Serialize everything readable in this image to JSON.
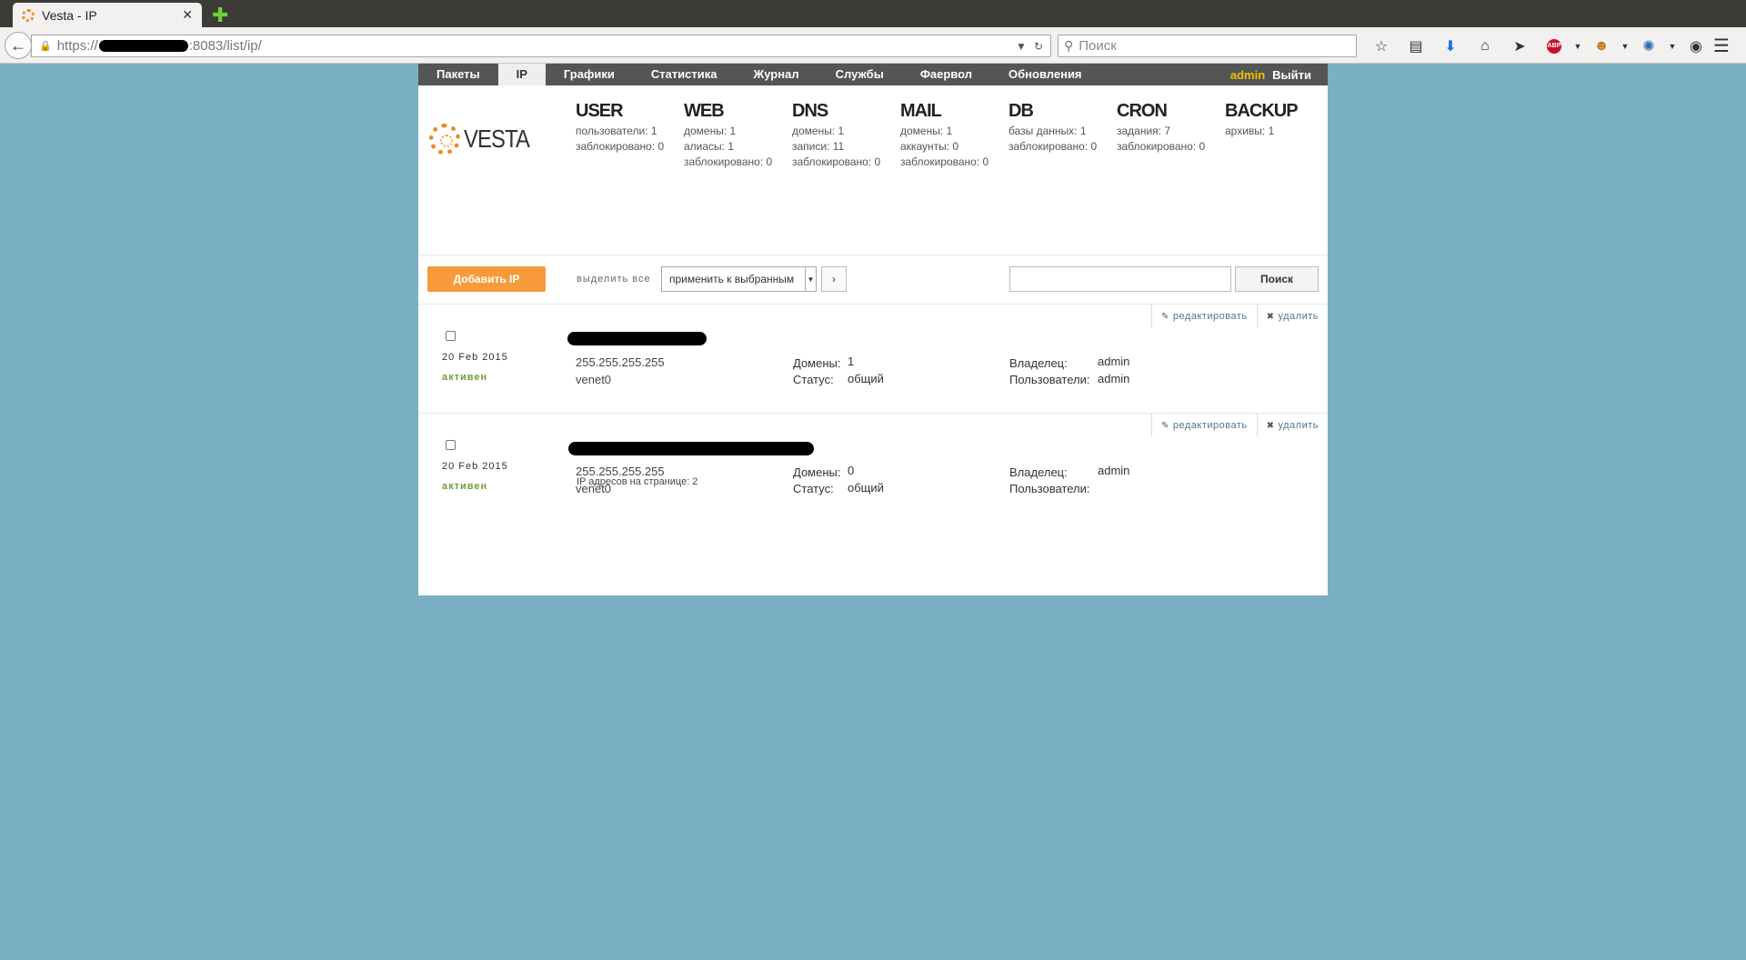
{
  "browser": {
    "tab_title": "Vesta - IP",
    "tab_close": "✕",
    "new_tab": "✚",
    "url_prefix": "https://",
    "url_suffix": ":8083/list/ip/",
    "search_placeholder": "Поиск"
  },
  "topmenu": {
    "items": [
      "Пакеты",
      "IP",
      "Графики",
      "Статистика",
      "Журнал",
      "Службы",
      "Фаервол",
      "Обновления"
    ],
    "active": "IP",
    "user": "admin",
    "logout": "Выйти"
  },
  "brand": {
    "logo_text": "VESTA"
  },
  "stats": [
    {
      "title": "USER",
      "lines": [
        "пользователи: 1",
        "заблокировано: 0"
      ]
    },
    {
      "title": "WEB",
      "lines": [
        "домены: 1",
        "алиасы: 1",
        "заблокировано: 0"
      ]
    },
    {
      "title": "DNS",
      "lines": [
        "домены: 1",
        "записи: 11",
        "заблокировано: 0"
      ]
    },
    {
      "title": "MAIL",
      "lines": [
        "домены: 1",
        "аккаунты: 0",
        "заблокировано: 0"
      ]
    },
    {
      "title": "DB",
      "lines": [
        "базы данных: 1",
        "заблокировано: 0"
      ]
    },
    {
      "title": "CRON",
      "lines": [
        "задания: 7",
        "заблокировано: 0"
      ]
    },
    {
      "title": "BACKUP",
      "lines": [
        "архивы: 1"
      ]
    }
  ],
  "actions": {
    "add_label": "Добавить IP",
    "select_all": "выделить все",
    "bulk_selected": "применить к выбранным",
    "bulk_go": "›",
    "search_button": "Поиск"
  },
  "row_actions": {
    "edit": "редактировать",
    "delete": "удалить"
  },
  "labels": {
    "domains": "Домены:",
    "status": "Статус:",
    "owner": "Владелец:",
    "users": "Пользователи:"
  },
  "ips": [
    {
      "date": "20 Feb 2015",
      "state": "активен",
      "netmask": "255.255.255.255",
      "interface": "venet0",
      "domains": "1",
      "status": "общий",
      "owner": "admin",
      "users": "admin"
    },
    {
      "date": "20 Feb 2015",
      "state": "активен",
      "netmask": "255.255.255.255",
      "interface": "venet0",
      "domains": "0",
      "status": "общий",
      "owner": "admin",
      "users": ""
    }
  ],
  "footer": {
    "count_text": "IP адресов на странице: 2"
  }
}
